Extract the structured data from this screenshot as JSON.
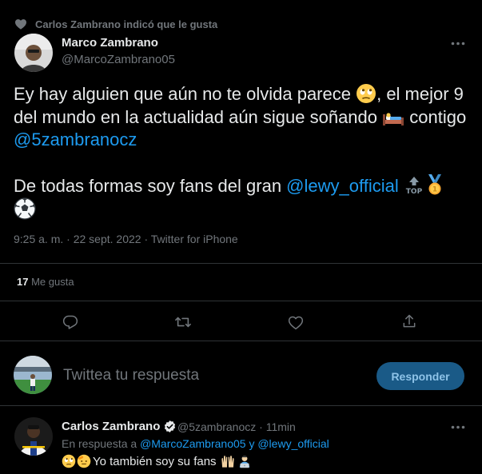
{
  "social_context": {
    "text": "Carlos Zambrano indicó que le gusta",
    "icon": "heart-icon"
  },
  "tweet": {
    "author_name": "Marco Zambrano",
    "author_handle": "@MarcoZambrano05",
    "p1": {
      "t1": "Ey hay alguien que aún no te olvida parece ",
      "t2": ", el mejor 9 del mundo en la actualidad aún sigue soñando ",
      "t3": " contigo ",
      "mention": "@5zambranocz",
      "emoji1": "eye-roll-emoji",
      "emoji2": "bed-emoji"
    },
    "p2": {
      "t1": "De todas formas soy fans del gran ",
      "mention": "@lewy_official",
      "emojis": [
        "top-arrow-emoji",
        "medal-emoji",
        "soccer-ball-emoji"
      ]
    },
    "time": "9:25 a. m.",
    "date": "22 sept. 2022",
    "source": "Twitter for iPhone",
    "dot": " · ",
    "likes_count": "17",
    "likes_label": "Me gusta"
  },
  "composer": {
    "placeholder": "Twittea tu respuesta",
    "button": "Responder"
  },
  "reply": {
    "name": "Carlos Zambrano",
    "handle": "@5zambranocz",
    "time": "11min",
    "context_prefix": "En respuesta a ",
    "context_mention1": "@MarcoZambrano05",
    "context_joiner": " y ",
    "context_mention2": "@lewy_official",
    "text": "Yo también soy su fans",
    "emojis": [
      "eye-roll-emoji",
      "saluting-face-emoji",
      "raising-hands-emoji",
      "technologist-emoji"
    ]
  },
  "colors": {
    "accent": "#1d9bf0",
    "background": "#000000",
    "text": "#e7e9ea",
    "muted": "#71767b",
    "border": "#2f3336"
  }
}
